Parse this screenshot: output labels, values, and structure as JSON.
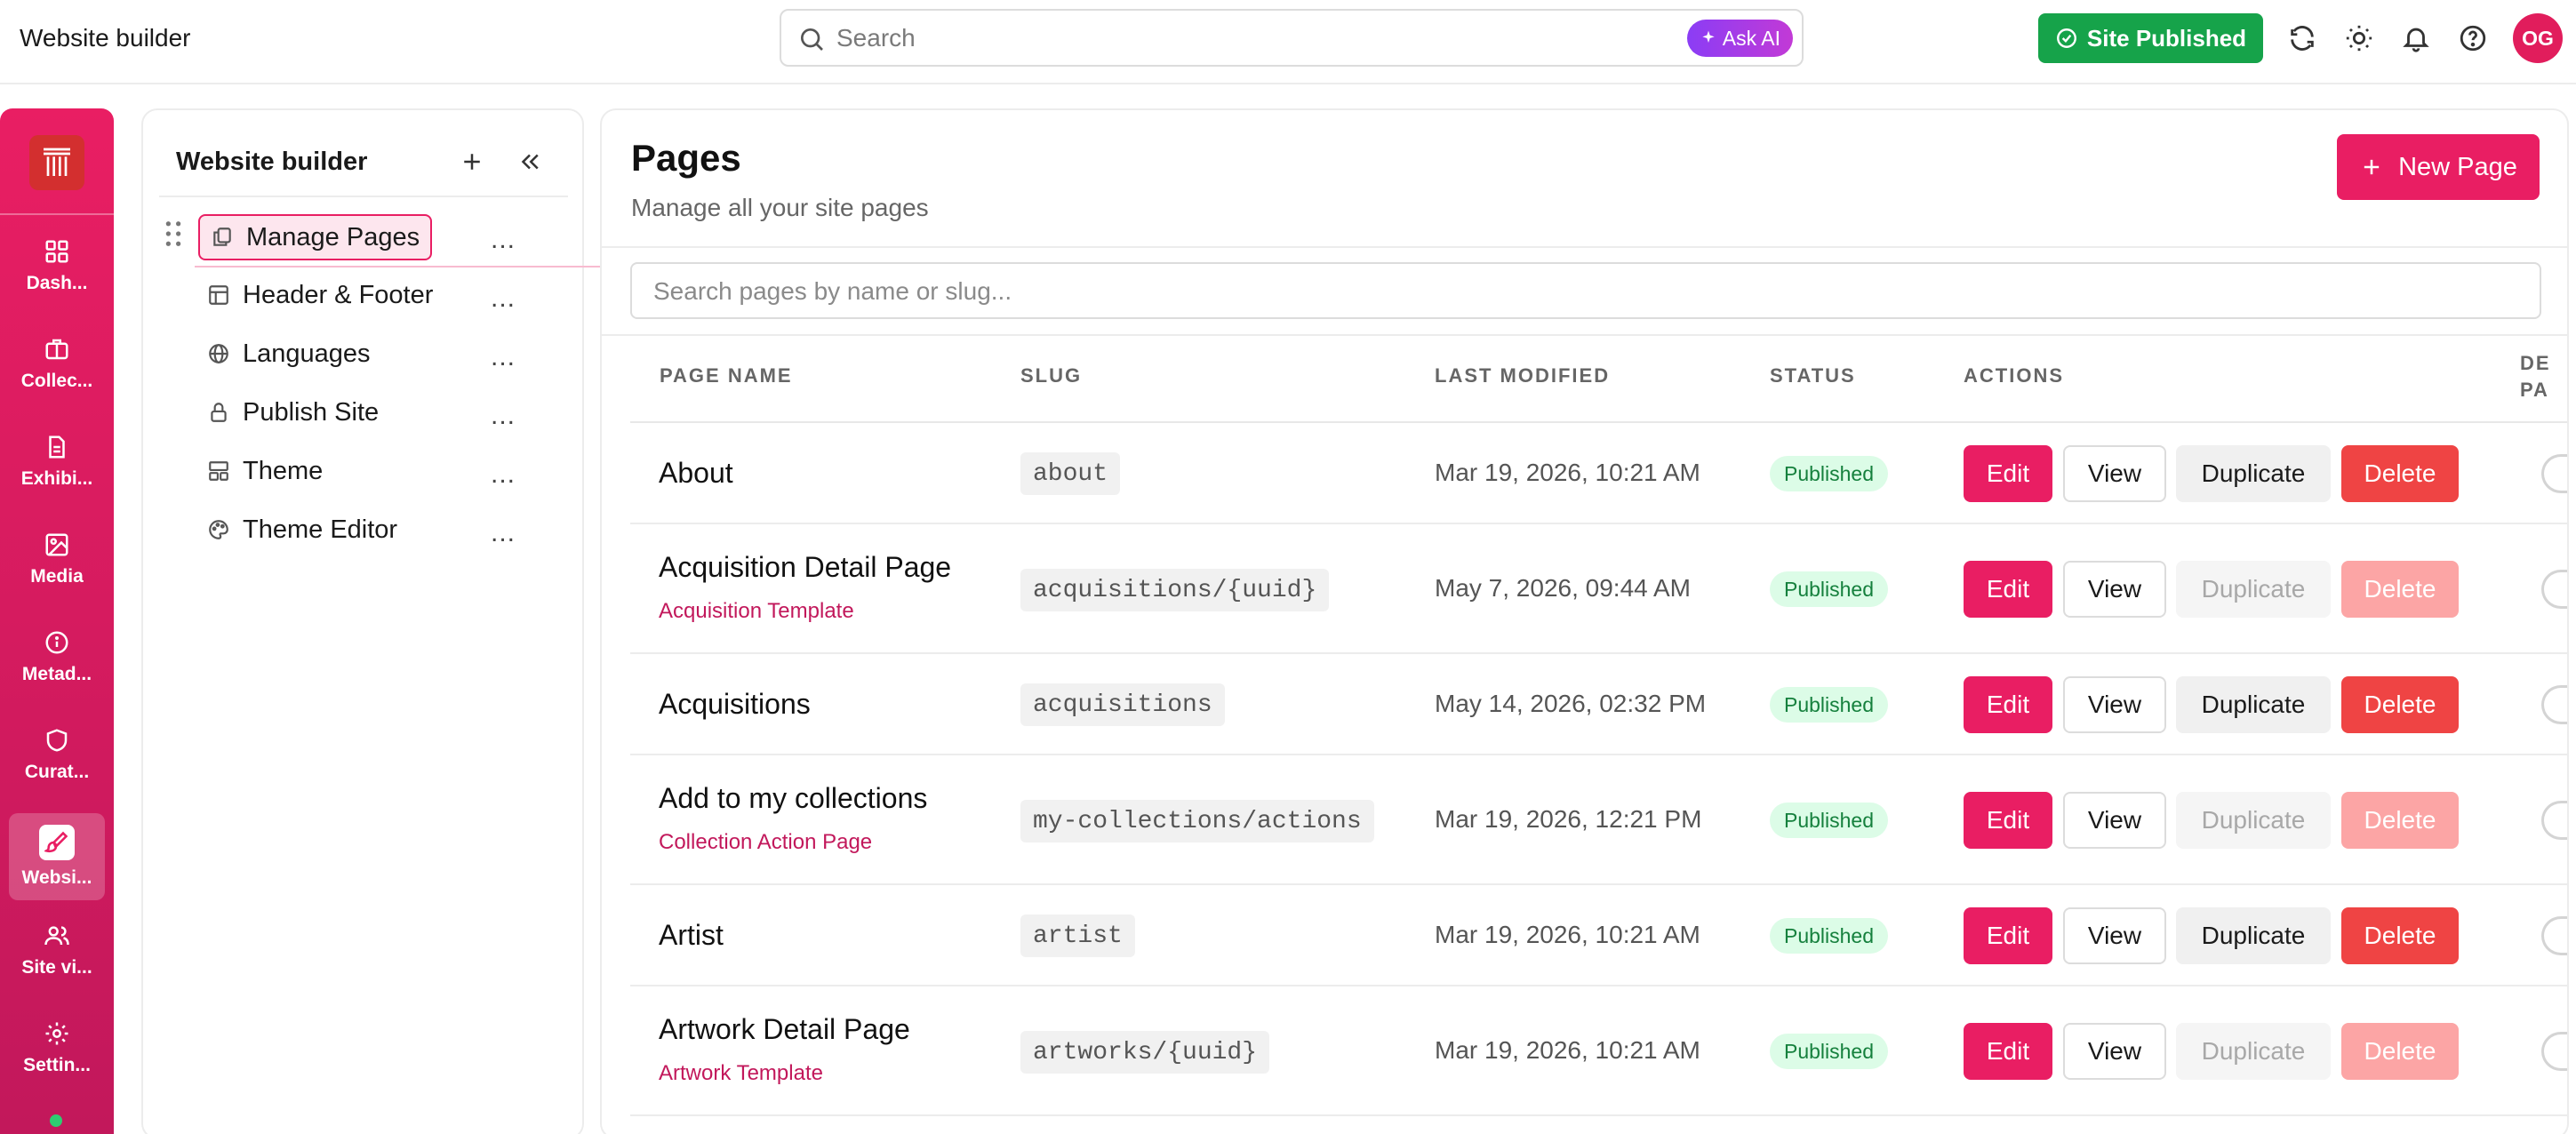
{
  "topbar": {
    "title": "Website builder",
    "search_placeholder": "Search",
    "ask_ai": "Ask AI",
    "site_published": "Site Published",
    "avatar_initials": "OG",
    "brand_color": "#e91e63",
    "published_color": "#16a34a"
  },
  "rail": {
    "items": [
      {
        "label": "Dash...",
        "icon": "dashboard-icon"
      },
      {
        "label": "Collec...",
        "icon": "briefcase-icon"
      },
      {
        "label": "Exhibi...",
        "icon": "document-icon"
      },
      {
        "label": "Media",
        "icon": "image-icon"
      },
      {
        "label": "Metad...",
        "icon": "info-icon"
      },
      {
        "label": "Curat...",
        "icon": "shield-icon"
      },
      {
        "label": "Websi...",
        "icon": "paintbrush-icon",
        "active": true
      },
      {
        "label": "Site vi...",
        "icon": "users-icon"
      },
      {
        "label": "Settin...",
        "icon": "gear-icon"
      }
    ]
  },
  "sidebar": {
    "title": "Website builder",
    "items": [
      {
        "label": "Manage Pages",
        "icon": "pages-icon",
        "active": true
      },
      {
        "label": "Header & Footer",
        "icon": "layout-icon"
      },
      {
        "label": "Languages",
        "icon": "globe-icon"
      },
      {
        "label": "Publish Site",
        "icon": "lock-icon"
      },
      {
        "label": "Theme",
        "icon": "theme-icon"
      },
      {
        "label": "Theme Editor",
        "icon": "palette-icon"
      }
    ],
    "more_label": "..."
  },
  "main": {
    "title": "Pages",
    "subtitle": "Manage all your site pages",
    "new_page_label": "New Page",
    "filter_placeholder": "Search pages by name or slug...",
    "columns": [
      "PAGE NAME",
      "SLUG",
      "LAST MODIFIED",
      "STATUS",
      "ACTIONS",
      "DE PA"
    ],
    "actions": {
      "edit": "Edit",
      "view": "View",
      "duplicate": "Duplicate",
      "delete": "Delete"
    },
    "rows": [
      {
        "name": "About",
        "template": "",
        "slug": "about",
        "modified": "Mar 19, 2026, 10:21 AM",
        "status": "Published",
        "actions_disabled": false
      },
      {
        "name": "Acquisition Detail Page",
        "template": "Acquisition Template",
        "slug": "acquisitions/{uuid}",
        "modified": "May 7, 2026, 09:44 AM",
        "status": "Published",
        "actions_disabled": true
      },
      {
        "name": "Acquisitions",
        "template": "",
        "slug": "acquisitions",
        "modified": "May 14, 2026, 02:32 PM",
        "status": "Published",
        "actions_disabled": false
      },
      {
        "name": "Add to my collections",
        "template": "Collection Action Page",
        "slug": "my-collections/actions",
        "modified": "Mar 19, 2026, 12:21 PM",
        "status": "Published",
        "actions_disabled": true
      },
      {
        "name": "Artist",
        "template": "",
        "slug": "artist",
        "modified": "Mar 19, 2026, 10:21 AM",
        "status": "Published",
        "actions_disabled": false
      },
      {
        "name": "Artwork Detail Page",
        "template": "Artwork Template",
        "slug": "artworks/{uuid}",
        "modified": "Mar 19, 2026, 10:21 AM",
        "status": "Published",
        "actions_disabled": true
      }
    ]
  }
}
